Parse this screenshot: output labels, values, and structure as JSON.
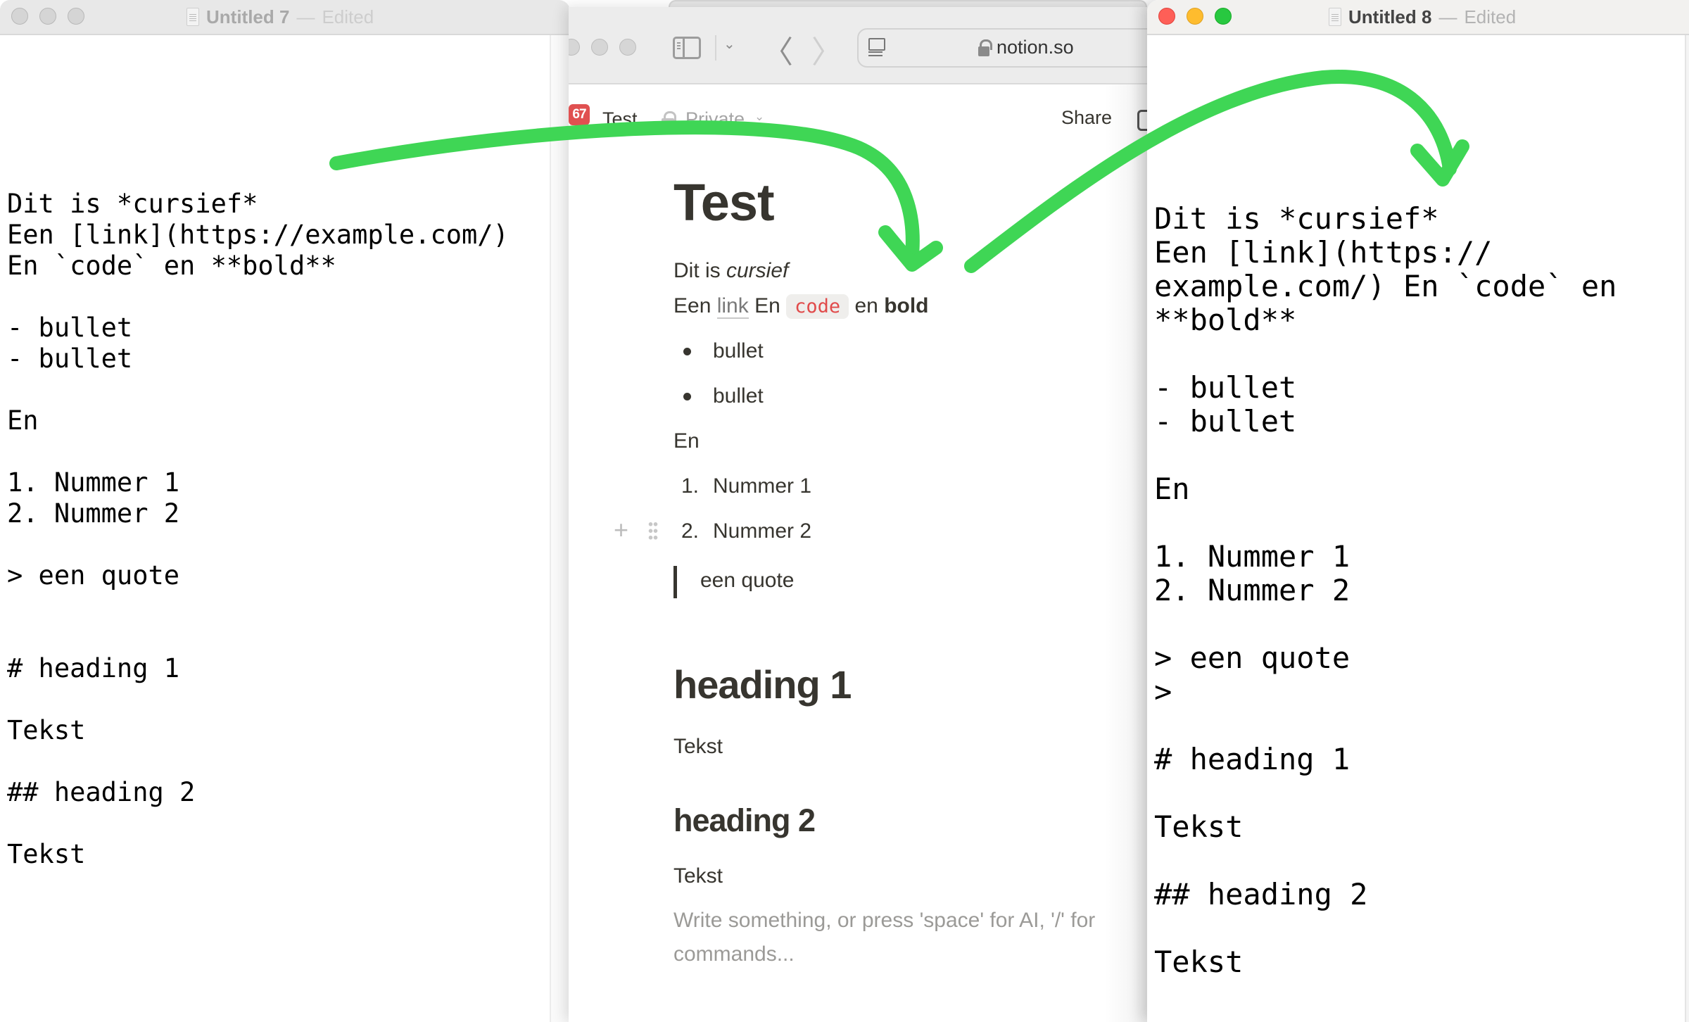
{
  "left_window": {
    "title": "Untitled 7",
    "separator": "—",
    "status": "Edited",
    "lines": [
      "Dit is *cursief*",
      "Een [link](https://example.com/)",
      "En `code` en **bold**",
      "",
      "- bullet",
      "- bullet",
      "",
      "En",
      "",
      "1. Nummer 1",
      "2. Nummer 2",
      "",
      "> een quote",
      "",
      "",
      "# heading 1",
      "",
      "Tekst",
      "",
      "## heading 2",
      "",
      "Tekst"
    ]
  },
  "safari": {
    "url": "notion.so",
    "header": {
      "badge_count": "67",
      "page_breadcrumb": "Test",
      "privacy": "Private",
      "share_label": "Share"
    },
    "page": {
      "title": "Test",
      "line1_prefix": "Dit is ",
      "line1_italic": "cursief",
      "line2_prefix": "Een ",
      "line2_link": "link",
      "line2_mid": " En ",
      "line2_code": "code",
      "line2_mid2": " en ",
      "line2_bold": "bold",
      "bullets": [
        "bullet",
        "bullet"
      ],
      "paragraph_en": "En",
      "numbered": [
        {
          "num": "1.",
          "text": "Nummer 1"
        },
        {
          "num": "2.",
          "text": "Nummer 2"
        }
      ],
      "quote": "een quote",
      "heading1": "heading 1",
      "text1": "Tekst",
      "heading2": "heading 2",
      "text2": "Tekst",
      "placeholder": "Write something, or press 'space' for AI, '/' for commands..."
    }
  },
  "right_window": {
    "title": "Untitled 8",
    "separator": "—",
    "status": "Edited",
    "lines": [
      "Dit is *cursief*",
      "Een [link](https://",
      "example.com/) En `code` en",
      "**bold**",
      "",
      "- bullet",
      "- bullet",
      "",
      "En",
      "",
      "1. Nummer 1",
      "2. Nummer 2",
      "",
      "> een quote",
      ">",
      "",
      "# heading 1",
      "",
      "Tekst",
      "",
      "## heading 2",
      "",
      "Tekst"
    ]
  },
  "annotation": {
    "arrow_color": "#3fd655"
  }
}
